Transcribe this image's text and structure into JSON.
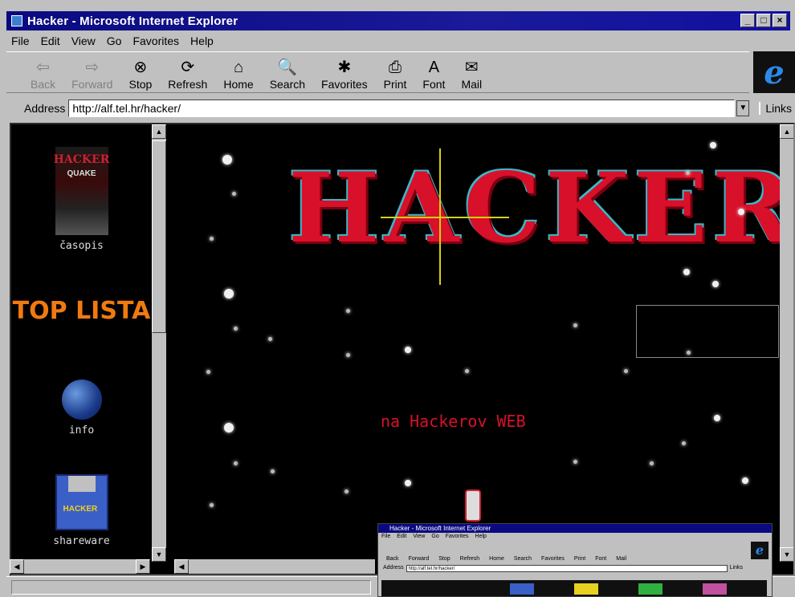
{
  "window": {
    "title": "Hacker - Microsoft Internet Explorer",
    "controls": [
      "_",
      "□",
      "×"
    ]
  },
  "menu": [
    "File",
    "Edit",
    "View",
    "Go",
    "Favorites",
    "Help"
  ],
  "toolbar": {
    "buttons": [
      {
        "label": "Back",
        "icon": "back-arrow-icon",
        "glyph": "⇦",
        "enabled": false
      },
      {
        "label": "Forward",
        "icon": "forward-arrow-icon",
        "glyph": "⇨",
        "enabled": false
      },
      {
        "label": "Stop",
        "icon": "stop-icon",
        "glyph": "⊗",
        "enabled": true
      },
      {
        "label": "Refresh",
        "icon": "refresh-icon",
        "glyph": "⟳",
        "enabled": true
      },
      {
        "label": "Home",
        "icon": "home-icon",
        "glyph": "⌂",
        "enabled": true
      },
      {
        "label": "Search",
        "icon": "search-icon",
        "glyph": "🔍",
        "enabled": true
      },
      {
        "label": "Favorites",
        "icon": "favorites-icon",
        "glyph": "✱",
        "enabled": true
      },
      {
        "label": "Print",
        "icon": "print-icon",
        "glyph": "⎙",
        "enabled": true
      },
      {
        "label": "Font",
        "icon": "font-icon",
        "glyph": "A",
        "enabled": true
      },
      {
        "label": "Mail",
        "icon": "mail-icon",
        "glyph": "✉",
        "enabled": true
      }
    ],
    "brand_logo": "e"
  },
  "address": {
    "label": "Address",
    "url": "http://alf.tel.hr/hacker/",
    "links_label": "Links"
  },
  "left_frame": {
    "items": [
      {
        "label": "časopis",
        "cover_title": "HACKER",
        "cover_subtitle": "QUAKE"
      },
      {
        "label": "TOP LISTA"
      },
      {
        "label": "info"
      },
      {
        "label": "shareware",
        "disk_text": "HACKER"
      }
    ]
  },
  "main_frame": {
    "logo_text": "HACKER",
    "welcome_text": "na Hackerov WEB"
  },
  "nested_window": {
    "title": "Hacker - Microsoft Internet Explorer",
    "menu": [
      "File",
      "Edit",
      "View",
      "Go",
      "Favorites",
      "Help"
    ],
    "toolbar": [
      "Back",
      "Forward",
      "Stop",
      "Refresh",
      "Home",
      "Search",
      "Favorites",
      "Print",
      "Font",
      "Mail"
    ],
    "address_label": "Address",
    "url": "http://alf.tel.hr/hacker/",
    "links_label": "Links"
  },
  "colors": {
    "title_bar": "#0a0a80",
    "logo_red": "#d8102a",
    "logo_outline": "#3ab8c8",
    "toplista_orange": "#f07a10"
  }
}
